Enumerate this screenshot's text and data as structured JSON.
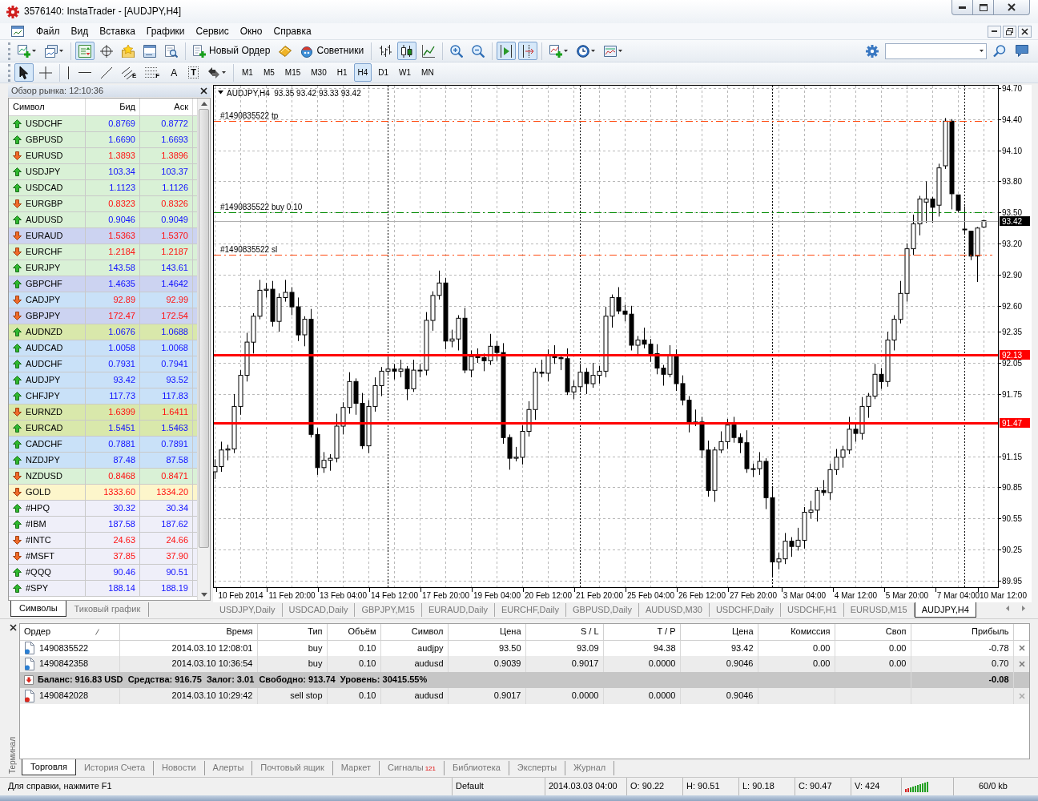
{
  "window": {
    "title": "3576140: InstaTrader - [AUDJPY,H4]"
  },
  "menu": [
    "Файл",
    "Вид",
    "Вставка",
    "Графики",
    "Сервис",
    "Окно",
    "Справка"
  ],
  "toolbar": {
    "groups": [
      [
        {
          "kind": "new-chart",
          "caret": true,
          "selected": false
        },
        {
          "kind": "profiles",
          "caret": true,
          "selected": false
        }
      ],
      [
        {
          "kind": "market-watch",
          "selected": true
        },
        {
          "kind": "data-window",
          "selected": false
        },
        {
          "kind": "navigator",
          "selected": false
        },
        {
          "kind": "terminal",
          "selected": false
        },
        {
          "kind": "tester",
          "selected": false
        }
      ],
      [
        {
          "kind": "new-order",
          "label": "Новый Ордер",
          "selected": false
        },
        {
          "kind": "editor",
          "selected": false
        },
        {
          "kind": "experts",
          "label": "Советники",
          "selected": false
        }
      ],
      [
        {
          "kind": "bar-chart",
          "selected": false
        },
        {
          "kind": "candle-chart",
          "selected": true
        },
        {
          "kind": "line-chart",
          "selected": false
        }
      ],
      [
        {
          "kind": "zoom-in",
          "selected": false
        },
        {
          "kind": "zoom-out",
          "selected": false
        }
      ],
      [
        {
          "kind": "autoscroll",
          "selected": true
        },
        {
          "kind": "chart-shift",
          "selected": true
        }
      ],
      [
        {
          "kind": "indicators",
          "caret": true,
          "selected": false
        },
        {
          "kind": "periods",
          "caret": true,
          "selected": false
        },
        {
          "kind": "templates",
          "caret": true,
          "selected": false
        }
      ]
    ]
  },
  "drawing_toolbar": {
    "groups": [
      [
        {
          "kind": "cursor",
          "selected": true
        },
        {
          "kind": "crosshair",
          "selected": false
        }
      ],
      [
        {
          "kind": "vertical-line",
          "selected": false
        },
        {
          "kind": "horizontal-line",
          "selected": false
        },
        {
          "kind": "trend-line",
          "selected": false
        },
        {
          "kind": "channel",
          "glyph": "E",
          "selected": false
        },
        {
          "kind": "fibonacci",
          "glyph": "F",
          "selected": false
        },
        {
          "kind": "text",
          "glyph": "A",
          "selected": false
        },
        {
          "kind": "text-label",
          "glyph": "T",
          "selected": false
        },
        {
          "kind": "arrows",
          "caret": true,
          "selected": false
        }
      ]
    ],
    "timeframes": [
      {
        "label": "M1",
        "selected": false
      },
      {
        "label": "M5",
        "selected": false
      },
      {
        "label": "M15",
        "selected": false
      },
      {
        "label": "M30",
        "selected": false
      },
      {
        "label": "H1",
        "selected": false
      },
      {
        "label": "H4",
        "selected": true
      },
      {
        "label": "D1",
        "selected": false
      },
      {
        "label": "W1",
        "selected": false
      },
      {
        "label": "MN",
        "selected": false
      }
    ]
  },
  "market_watch": {
    "title": "Обзор рынка: 12:10:36",
    "columns": [
      "Символ",
      "Бид",
      "Аск"
    ],
    "rows": [
      {
        "symbol": "USDCHF",
        "bid": "0.8769",
        "ask": "0.8772",
        "rising": true,
        "color": "#d9f1d6"
      },
      {
        "symbol": "GBPUSD",
        "bid": "1.6690",
        "ask": "1.6693",
        "rising": true,
        "color": "#d9f1d6"
      },
      {
        "symbol": "EURUSD",
        "bid": "1.3893",
        "ask": "1.3896",
        "rising": false,
        "color": "#d9f1d6"
      },
      {
        "symbol": "USDJPY",
        "bid": "103.34",
        "ask": "103.37",
        "rising": true,
        "color": "#d9f1d6"
      },
      {
        "symbol": "USDCAD",
        "bid": "1.1123",
        "ask": "1.1126",
        "rising": true,
        "color": "#d9f1d6"
      },
      {
        "symbol": "EURGBP",
        "bid": "0.8323",
        "ask": "0.8326",
        "rising": false,
        "color": "#d9f1d6"
      },
      {
        "symbol": "AUDUSD",
        "bid": "0.9046",
        "ask": "0.9049",
        "rising": true,
        "color": "#d9f1d6"
      },
      {
        "symbol": "EURAUD",
        "bid": "1.5363",
        "ask": "1.5370",
        "rising": false,
        "color": "#ccd3f1"
      },
      {
        "symbol": "EURCHF",
        "bid": "1.2184",
        "ask": "1.2187",
        "rising": false,
        "color": "#d9f1d6"
      },
      {
        "symbol": "EURJPY",
        "bid": "143.58",
        "ask": "143.61",
        "rising": true,
        "color": "#d9f1d6"
      },
      {
        "symbol": "GBPCHF",
        "bid": "1.4635",
        "ask": "1.4642",
        "rising": true,
        "color": "#ccd3f1"
      },
      {
        "symbol": "CADJPY",
        "bid": "92.89",
        "ask": "92.99",
        "rising": false,
        "color": "#c9e1f8"
      },
      {
        "symbol": "GBPJPY",
        "bid": "172.47",
        "ask": "172.54",
        "rising": false,
        "color": "#ccd3f1"
      },
      {
        "symbol": "AUDNZD",
        "bid": "1.0676",
        "ask": "1.0688",
        "rising": true,
        "color": "#d9e8ab"
      },
      {
        "symbol": "AUDCAD",
        "bid": "1.0058",
        "ask": "1.0068",
        "rising": true,
        "color": "#c9e1f8"
      },
      {
        "symbol": "AUDCHF",
        "bid": "0.7931",
        "ask": "0.7941",
        "rising": true,
        "color": "#c9e1f8"
      },
      {
        "symbol": "AUDJPY",
        "bid": "93.42",
        "ask": "93.52",
        "rising": true,
        "color": "#c9e1f8"
      },
      {
        "symbol": "CHFJPY",
        "bid": "117.73",
        "ask": "117.83",
        "rising": true,
        "color": "#c9e1f8"
      },
      {
        "symbol": "EURNZD",
        "bid": "1.6399",
        "ask": "1.6411",
        "rising": false,
        "color": "#d9e8ab"
      },
      {
        "symbol": "EURCAD",
        "bid": "1.5451",
        "ask": "1.5463",
        "rising": true,
        "color": "#d9e8ab"
      },
      {
        "symbol": "CADCHF",
        "bid": "0.7881",
        "ask": "0.7891",
        "rising": true,
        "color": "#c9e1f8"
      },
      {
        "symbol": "NZDJPY",
        "bid": "87.48",
        "ask": "87.58",
        "rising": true,
        "color": "#c9e1f8"
      },
      {
        "symbol": "NZDUSD",
        "bid": "0.8468",
        "ask": "0.8471",
        "rising": false,
        "color": "#d9f1d6"
      },
      {
        "symbol": "GOLD",
        "bid": "1333.60",
        "ask": "1334.20",
        "rising": false,
        "color": "#fdf6cb"
      },
      {
        "symbol": "#HPQ",
        "bid": "30.32",
        "ask": "30.34",
        "rising": true,
        "color": "#efeff9"
      },
      {
        "symbol": "#IBM",
        "bid": "187.58",
        "ask": "187.62",
        "rising": true,
        "color": "#efeff9"
      },
      {
        "symbol": "#INTC",
        "bid": "24.63",
        "ask": "24.66",
        "rising": false,
        "color": "#efeff9"
      },
      {
        "symbol": "#MSFT",
        "bid": "37.85",
        "ask": "37.90",
        "rising": false,
        "color": "#efeff9"
      },
      {
        "symbol": "#QQQ",
        "bid": "90.46",
        "ask": "90.51",
        "rising": true,
        "color": "#efeff9"
      },
      {
        "symbol": "#SPY",
        "bid": "188.14",
        "ask": "188.19",
        "rising": true,
        "color": "#efeff9"
      }
    ],
    "tabs": [
      {
        "label": "Символы",
        "selected": true
      },
      {
        "label": "Тиковый график",
        "selected": false
      }
    ]
  },
  "chart": {
    "header": "AUDJPY,H4  93.35 93.42 93.33 93.42",
    "chart_data": {
      "type": "candlestick",
      "grid": true,
      "categories": [
        null,
        null,
        null,
        null,
        "10 Feb 2014",
        null,
        null,
        null,
        null,
        null,
        null,
        null,
        "11 Feb 20:00",
        null,
        null,
        null,
        null,
        null,
        null,
        null,
        "13 Feb 04:00",
        null,
        null,
        null,
        null,
        null,
        null,
        null,
        "14 Feb 12:00",
        null,
        null,
        null,
        null,
        null,
        null,
        null,
        "17 Feb 20:00",
        null,
        null,
        null,
        null,
        null,
        null,
        null,
        "19 Feb 04:00",
        null,
        null,
        null,
        null,
        null,
        null,
        null,
        "20 Feb 12:00",
        null,
        null,
        null,
        null,
        null,
        null,
        null,
        "21 Feb 20:00",
        null,
        null,
        null,
        null,
        null,
        null,
        null,
        "25 Feb 04:00",
        null,
        null,
        null,
        null,
        null,
        null,
        null,
        "26 Feb 12:00",
        null,
        null,
        null,
        null,
        null,
        null,
        null,
        "27 Feb 20:00",
        null,
        null,
        null,
        null,
        null,
        null,
        null,
        "3 Mar 04:00",
        null,
        null,
        null,
        null,
        null,
        null,
        null,
        "4 Mar 12:00",
        null,
        null,
        null,
        null,
        null,
        null,
        null,
        "5 Mar 20:00",
        null,
        null,
        null,
        null,
        null,
        null,
        null,
        "7 Mar 04:00",
        null,
        null,
        null,
        null,
        null,
        null,
        "10 Mar 12:00"
      ],
      "ohlc": [
        [
          91.0,
          91.12,
          90.93,
          91.05
        ],
        [
          91.05,
          91.29,
          91.0,
          91.21
        ],
        [
          91.21,
          91.26,
          91.11,
          91.22
        ],
        [
          91.22,
          91.75,
          91.18,
          91.63
        ],
        [
          91.63,
          91.98,
          91.55,
          91.93
        ],
        [
          91.93,
          92.34,
          91.87,
          92.25
        ],
        [
          92.25,
          92.53,
          92.14,
          92.5
        ],
        [
          92.5,
          92.85,
          92.47,
          92.75
        ],
        [
          92.75,
          92.82,
          92.68,
          92.76
        ],
        [
          92.76,
          92.84,
          92.4,
          92.45
        ],
        [
          92.45,
          92.72,
          92.35,
          92.68
        ],
        [
          92.68,
          92.85,
          92.64,
          92.73
        ],
        [
          92.73,
          92.78,
          92.51,
          92.59
        ],
        [
          92.59,
          92.68,
          92.26,
          92.32
        ],
        [
          92.32,
          92.5,
          92.21,
          92.47
        ],
        [
          92.47,
          92.57,
          91.33,
          91.36
        ],
        [
          91.36,
          91.42,
          90.97,
          91.04
        ],
        [
          91.04,
          91.19,
          90.99,
          91.11
        ],
        [
          91.11,
          91.17,
          91.01,
          91.13
        ],
        [
          91.13,
          91.56,
          91.09,
          91.44
        ],
        [
          91.44,
          91.67,
          91.36,
          91.62
        ],
        [
          91.62,
          91.96,
          91.56,
          91.87
        ],
        [
          91.87,
          91.9,
          91.55,
          91.66
        ],
        [
          91.66,
          91.76,
          91.22,
          91.25
        ],
        [
          91.25,
          91.69,
          91.18,
          91.63
        ],
        [
          91.63,
          91.91,
          91.58,
          91.83
        ],
        [
          91.83,
          92.01,
          91.73,
          91.97
        ],
        [
          91.97,
          92.11,
          91.93,
          91.99
        ],
        [
          91.99,
          92.04,
          91.89,
          91.97
        ],
        [
          91.97,
          92.08,
          91.91,
          91.99
        ],
        [
          91.99,
          92.02,
          91.69,
          91.8
        ],
        [
          91.8,
          92.08,
          91.77,
          91.98
        ],
        [
          91.98,
          92.04,
          91.91,
          91.98
        ],
        [
          91.98,
          92.54,
          91.93,
          92.46
        ],
        [
          92.46,
          92.74,
          92.36,
          92.7
        ],
        [
          92.7,
          92.94,
          92.66,
          92.82
        ],
        [
          92.82,
          92.87,
          92.18,
          92.26
        ],
        [
          92.26,
          92.37,
          92.2,
          92.28
        ],
        [
          92.28,
          92.51,
          92.17,
          92.48
        ],
        [
          92.48,
          92.58,
          91.95,
          91.98
        ],
        [
          91.98,
          92.17,
          91.91,
          92.11
        ],
        [
          92.11,
          92.19,
          92.05,
          92.1
        ],
        [
          92.1,
          92.14,
          91.97,
          92.07
        ],
        [
          92.07,
          92.33,
          92.03,
          92.21
        ],
        [
          92.21,
          92.26,
          92.07,
          92.15
        ],
        [
          92.15,
          92.24,
          91.27,
          91.33
        ],
        [
          91.33,
          91.36,
          91.02,
          91.13
        ],
        [
          91.13,
          91.24,
          91.1,
          91.14
        ],
        [
          91.14,
          91.45,
          91.07,
          91.39
        ],
        [
          91.39,
          91.68,
          91.34,
          91.6
        ],
        [
          91.6,
          92.0,
          91.5,
          91.96
        ],
        [
          91.96,
          92.08,
          91.91,
          91.95
        ],
        [
          91.95,
          92.18,
          91.87,
          92.13
        ],
        [
          92.13,
          92.22,
          92.04,
          92.1
        ],
        [
          92.1,
          92.13,
          91.98,
          92.09
        ],
        [
          92.09,
          92.19,
          91.74,
          91.77
        ],
        [
          91.77,
          91.88,
          91.7,
          91.82
        ],
        [
          91.82,
          92.04,
          91.77,
          91.96
        ],
        [
          91.96,
          92.0,
          91.75,
          91.85
        ],
        [
          91.85,
          92.05,
          91.81,
          91.93
        ],
        [
          91.93,
          92.02,
          91.85,
          91.97
        ],
        [
          91.97,
          92.59,
          91.91,
          92.5
        ],
        [
          92.5,
          92.71,
          92.39,
          92.68
        ],
        [
          92.68,
          92.78,
          92.52,
          92.55
        ],
        [
          92.55,
          92.61,
          92.45,
          92.52
        ],
        [
          92.52,
          92.6,
          92.17,
          92.22
        ],
        [
          92.22,
          92.31,
          92.12,
          92.27
        ],
        [
          92.27,
          92.39,
          92.19,
          92.23
        ],
        [
          92.23,
          92.28,
          92.06,
          92.14
        ],
        [
          92.14,
          92.23,
          91.94,
          92.0
        ],
        [
          92.0,
          92.03,
          91.83,
          91.94
        ],
        [
          91.94,
          92.22,
          91.91,
          92.12
        ],
        [
          92.12,
          92.18,
          91.78,
          91.85
        ],
        [
          91.85,
          91.93,
          91.64,
          91.69
        ],
        [
          91.69,
          91.73,
          91.38,
          91.48
        ],
        [
          91.48,
          91.6,
          91.44,
          91.48
        ],
        [
          91.48,
          91.53,
          91.13,
          91.21
        ],
        [
          91.21,
          91.3,
          90.76,
          90.82
        ],
        [
          90.82,
          91.24,
          90.71,
          91.21
        ],
        [
          91.21,
          91.39,
          91.18,
          91.29
        ],
        [
          91.29,
          91.51,
          91.22,
          91.45
        ],
        [
          91.45,
          91.53,
          91.28,
          91.33
        ],
        [
          91.33,
          91.37,
          91.18,
          91.28
        ],
        [
          91.28,
          91.4,
          90.99,
          91.03
        ],
        [
          91.03,
          91.08,
          90.95,
          91.03
        ],
        [
          91.03,
          91.19,
          90.97,
          91.1
        ],
        [
          91.1,
          91.13,
          90.64,
          90.75
        ],
        [
          90.75,
          90.85,
          89.98,
          90.13
        ],
        [
          90.13,
          90.22,
          90.06,
          90.16
        ],
        [
          90.16,
          90.41,
          90.11,
          90.33
        ],
        [
          90.33,
          90.37,
          90.18,
          90.28
        ],
        [
          90.28,
          90.46,
          90.24,
          90.34
        ],
        [
          90.34,
          90.66,
          90.26,
          90.61
        ],
        [
          90.61,
          90.72,
          90.55,
          90.63
        ],
        [
          90.63,
          90.85,
          90.52,
          90.82
        ],
        [
          90.82,
          90.92,
          90.77,
          90.8
        ],
        [
          90.8,
          91.08,
          90.73,
          91.02
        ],
        [
          91.02,
          91.22,
          90.97,
          91.14
        ],
        [
          91.14,
          91.25,
          91.04,
          91.21
        ],
        [
          91.21,
          91.53,
          91.17,
          91.41
        ],
        [
          91.41,
          91.46,
          91.29,
          91.37
        ],
        [
          91.37,
          91.72,
          91.31,
          91.63
        ],
        [
          91.63,
          91.76,
          91.52,
          91.73
        ],
        [
          91.73,
          92.04,
          91.7,
          91.94
        ],
        [
          91.94,
          92.0,
          91.8,
          91.87
        ],
        [
          91.87,
          92.35,
          91.82,
          92.27
        ],
        [
          92.27,
          92.51,
          92.17,
          92.47
        ],
        [
          92.47,
          92.84,
          92.43,
          92.72
        ],
        [
          92.72,
          93.2,
          92.64,
          93.15
        ],
        [
          93.15,
          93.48,
          93.09,
          93.39
        ],
        [
          93.39,
          93.66,
          93.28,
          93.63
        ],
        [
          93.6,
          93.8,
          93.4,
          93.63
        ],
        [
          93.63,
          93.65,
          93.4,
          93.55
        ],
        [
          93.57,
          93.97,
          93.46,
          93.93
        ],
        [
          93.95,
          94.41,
          93.92,
          94.38
        ],
        [
          94.38,
          94.4,
          93.53,
          93.68
        ],
        [
          93.67,
          93.67,
          93.5,
          93.52
        ],
        [
          93.34,
          93.56,
          93.3,
          93.34
        ],
        [
          93.32,
          93.32,
          93.04,
          93.08
        ],
        [
          93.08,
          93.36,
          92.83,
          93.35
        ],
        [
          93.36,
          93.43,
          93.35,
          93.42
        ],
        null,
        null,
        null
      ],
      "ylim": [
        89.88,
        94.73
      ],
      "yticks": [
        {
          "value": 94.7,
          "label": "94.70"
        },
        {
          "value": 94.4,
          "label": "94.40"
        },
        {
          "value": 94.1,
          "label": "94.10"
        },
        {
          "value": 93.8,
          "label": "93.80"
        },
        {
          "value": 93.5,
          "label": "93.50"
        },
        {
          "value": 93.2,
          "label": "93.20"
        },
        {
          "value": 92.9,
          "label": "92.90"
        },
        {
          "value": 92.6,
          "label": "92.60"
        },
        {
          "value": 92.35,
          "label": "92.35"
        },
        {
          "value": 92.05,
          "label": "92.05"
        },
        {
          "value": 91.75,
          "label": "91.75"
        },
        {
          "value": 91.15,
          "label": "91.15"
        },
        {
          "value": 90.85,
          "label": "90.85"
        },
        {
          "value": 90.55,
          "label": "90.55"
        },
        {
          "value": 90.25,
          "label": "90.25"
        },
        {
          "value": 89.95,
          "label": "89.95"
        }
      ],
      "ref_lines": [
        {
          "axis": "y",
          "value": 94.38,
          "label": "#1490835522 tp",
          "color": "#ff4a10"
        },
        {
          "axis": "y",
          "value": 93.5,
          "label": "#1490835522 buy 0.10",
          "color": "#008a00"
        },
        {
          "axis": "y",
          "value": 93.42,
          "label": "93.42",
          "color": "#b0b0b0"
        },
        {
          "axis": "y",
          "value": 93.09,
          "label": "#1490835522 sl",
          "color": "#ff4a10"
        },
        {
          "axis": "y",
          "value": 92.13,
          "label": "92.13",
          "color": "#ff0000"
        },
        {
          "axis": "y",
          "value": 91.47,
          "label": "91.47",
          "color": "#ff0000"
        }
      ]
    },
    "tabs": [
      {
        "label": "USDJPY,Daily",
        "selected": false
      },
      {
        "label": "USDCAD,Daily",
        "selected": false
      },
      {
        "label": "GBPJPY,M15",
        "selected": false
      },
      {
        "label": "EURAUD,Daily",
        "selected": false
      },
      {
        "label": "EURCHF,Daily",
        "selected": false
      },
      {
        "label": "GBPUSD,Daily",
        "selected": false
      },
      {
        "label": "AUDUSD,M30",
        "selected": false
      },
      {
        "label": "USDCHF,Daily",
        "selected": false
      },
      {
        "label": "USDCHF,H1",
        "selected": false
      },
      {
        "label": "EURUSD,M15",
        "selected": false
      },
      {
        "label": "AUDJPY,H4",
        "selected": true
      }
    ]
  },
  "terminal": {
    "title": "Терминал",
    "columns": [
      "Ордер",
      "Время",
      "Тип",
      "Объём",
      "Символ",
      "Цена",
      "S / L",
      "T / P",
      "Цена",
      "Комиссия",
      "Своп",
      "Прибыль"
    ],
    "positions": [
      {
        "order": "1490835522",
        "time": "2014.03.10 12:08:01",
        "type": "buy",
        "volume": "0.10",
        "symbol": "audjpy",
        "open_price": "93.50",
        "sl": "93.09",
        "tp": "94.38",
        "price": "93.42",
        "commission": "0.00",
        "swap": "0.00",
        "profit": "-0.78"
      },
      {
        "order": "1490842358",
        "time": "2014.03.10 10:36:54",
        "type": "buy",
        "volume": "0.10",
        "symbol": "audusd",
        "open_price": "0.9039",
        "sl": "0.9017",
        "tp": "0.0000",
        "price": "0.9046",
        "commission": "0.00",
        "swap": "0.00",
        "profit": "0.70"
      }
    ],
    "balance": {
      "text": "Баланс: 916.83 USD  Средства: 916.75  Залог: 3.01  Свободно: 913.74  Уровень: 30415.55%",
      "profit": "-0.08"
    },
    "pending": [
      {
        "order": "1490842028",
        "time": "2014.03.10 10:29:42",
        "type": "sell stop",
        "volume": "0.10",
        "symbol": "audusd",
        "open_price": "0.9017",
        "sl": "0.0000",
        "tp": "0.0000",
        "price": "0.9046"
      }
    ],
    "tabs": [
      {
        "label": "Торговля",
        "selected": true
      },
      {
        "label": "История Счета",
        "selected": false
      },
      {
        "label": "Новости",
        "selected": false
      },
      {
        "label": "Алерты",
        "selected": false
      },
      {
        "label": "Почтовый ящик",
        "selected": false
      },
      {
        "label": "Маркет",
        "selected": false
      },
      {
        "label": "Сигналы",
        "badge": "121",
        "selected": false
      },
      {
        "label": "Библиотека",
        "selected": false
      },
      {
        "label": "Эксперты",
        "selected": false
      },
      {
        "label": "Журнал",
        "selected": false
      }
    ]
  },
  "status_bar": {
    "help": "Для справки, нажмите F1",
    "profile": "Default",
    "time": "2014.03.03 04:00",
    "open": "O: 90.22",
    "high": "H: 90.51",
    "low": "L: 90.18",
    "close": "C: 90.47",
    "volume": "V: 424",
    "traffic": "60/0 kb"
  }
}
